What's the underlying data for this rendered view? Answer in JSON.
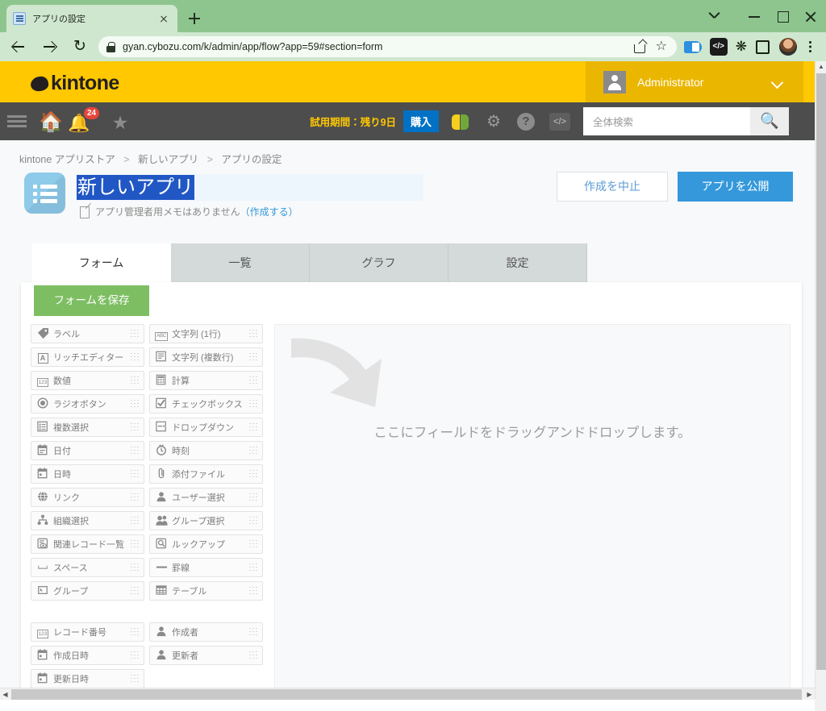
{
  "browser": {
    "tab": {
      "title": "アプリの設定",
      "favicon": "app-list-favicon",
      "close": "×"
    },
    "new_tab": "+",
    "window_controls": {
      "chevron": "chevron-down",
      "minimize": "−",
      "maximize": "□",
      "close": "×"
    },
    "nav": {
      "back": "←",
      "forward": "→",
      "reload": "⟳"
    },
    "omnibox": {
      "url": "gyan.cybozu.com/k/admin/app/flow?app=59#section=form",
      "lock": "lock-icon"
    },
    "toolbar_icons": [
      "share-icon",
      "bookmark-star-icon",
      "extension-blue-icon",
      "devtools-icon",
      "puzzle-extensions-icon",
      "side-panel-icon",
      "profile-avatar",
      "chrome-menu-kebab"
    ],
    "devtools_label": "</>"
  },
  "kintone_header": {
    "logo_text": "kintone",
    "user": {
      "name": "Administrator",
      "avatar": "user-avatar-icon",
      "caret": "chevron-down-icon"
    }
  },
  "nav_bar": {
    "menu_icon": "hamburger-icon",
    "home_icon": "home-icon",
    "bell_icon": "notification-bell-icon",
    "bell_badge": "24",
    "star_icon": "favorites-star-icon",
    "trial_text": "試用期間：残り9日",
    "buy_button": "購入",
    "leaf_icon": "new-leaf-icon",
    "gear_icon": "gear-icon",
    "help_icon": "help-icon",
    "code_icon": "</>",
    "search_placeholder": "全体検索",
    "search_button": "search-icon"
  },
  "breadcrumb": {
    "items": [
      "kintone アプリストア",
      "新しいアプリ",
      "アプリの設定"
    ],
    "separator": ">"
  },
  "app": {
    "icon": "app-list-icon",
    "title_value": "新しいアプリ",
    "memo_text": "アプリ管理者用メモはありません",
    "memo_link": "（作成する）",
    "cancel_button": "作成を中止",
    "publish_button": "アプリを公開"
  },
  "tabs": [
    {
      "label": "フォーム",
      "active": true
    },
    {
      "label": "一覧",
      "active": false
    },
    {
      "label": "グラフ",
      "active": false
    },
    {
      "label": "設定",
      "active": false
    }
  ],
  "form_editor": {
    "save_button": "フォームを保存",
    "dropzone_text": "ここにフィールドをドラッグアンドドロップします。",
    "dropzone_arrow": "curved-arrow-icon",
    "palette_groups": [
      {
        "group": "field-types",
        "items": [
          {
            "label": "ラベル",
            "icon": "tag-icon"
          },
          {
            "label": "文字列 (1行)",
            "icon": "abc-icon"
          },
          {
            "label": "リッチエディター",
            "icon": "rich-text-icon"
          },
          {
            "label": "文字列 (複数行)",
            "icon": "multiline-text-icon"
          },
          {
            "label": "数値",
            "icon": "number-123-icon"
          },
          {
            "label": "計算",
            "icon": "calculator-icon"
          },
          {
            "label": "ラジオボタン",
            "icon": "radio-button-icon"
          },
          {
            "label": "チェックボックス",
            "icon": "checkbox-icon"
          },
          {
            "label": "複数選択",
            "icon": "multi-select-icon"
          },
          {
            "label": "ドロップダウン",
            "icon": "dropdown-icon"
          },
          {
            "label": "日付",
            "icon": "calendar-date-icon"
          },
          {
            "label": "時刻",
            "icon": "clock-icon"
          },
          {
            "label": "日時",
            "icon": "calendar-datetime-icon"
          },
          {
            "label": "添付ファイル",
            "icon": "paperclip-icon"
          },
          {
            "label": "リンク",
            "icon": "globe-link-icon"
          },
          {
            "label": "ユーザー選択",
            "icon": "user-select-icon"
          },
          {
            "label": "組織選択",
            "icon": "org-tree-icon"
          },
          {
            "label": "グループ選択",
            "icon": "group-select-icon"
          },
          {
            "label": "関連レコード一覧",
            "icon": "related-records-icon"
          },
          {
            "label": "ルックアップ",
            "icon": "lookup-search-icon"
          },
          {
            "label": "スペース",
            "icon": "space-icon"
          },
          {
            "label": "罫線",
            "icon": "horizontal-rule-icon"
          },
          {
            "label": "グループ",
            "icon": "field-group-icon"
          },
          {
            "label": "テーブル",
            "icon": "table-icon"
          }
        ]
      },
      {
        "group": "system-fields",
        "items": [
          {
            "label": "レコード番号",
            "icon": "number-123-icon"
          },
          {
            "label": "作成者",
            "icon": "user-select-icon"
          },
          {
            "label": "作成日時",
            "icon": "calendar-datetime-icon"
          },
          {
            "label": "更新者",
            "icon": "user-select-icon"
          },
          {
            "label": "更新日時",
            "icon": "calendar-datetime-icon"
          }
        ]
      }
    ]
  },
  "colors": {
    "kintone_yellow": "#ffc800",
    "nav_dark": "#4d4d4d",
    "accent_blue": "#3498db",
    "save_green": "#7ebe63",
    "badge_red": "#e8443a",
    "buy_blue": "#0071c5",
    "browser_green": "#8ec58e"
  }
}
